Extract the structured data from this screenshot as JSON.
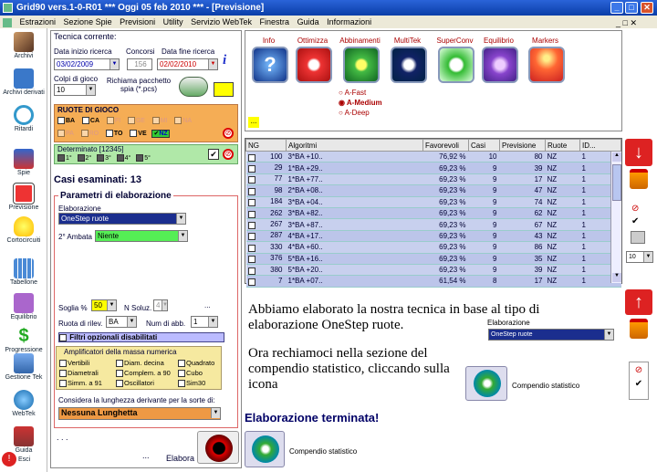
{
  "window": {
    "title": "Grid90 vers.1-0-R01   ***  Oggi 05 feb 2010   ***   - [Previsione]"
  },
  "menu": [
    "Estrazioni",
    "Sezione Spie",
    "Previsioni",
    "Utility",
    "Servizio WebTek",
    "Finestra",
    "Guida",
    "Informazioni"
  ],
  "sidebar": [
    "Archivi",
    "Archivi derivati",
    "Ritardi",
    "Spie",
    "Previsione",
    "Cortocircuiti",
    "Tabellone",
    "Equilibrio",
    "Progressione",
    "Gestione Tek",
    "WebTek",
    "Guida",
    "Esci"
  ],
  "tecnica": {
    "title": "Tecnica corrente:",
    "data_inizio_label": "Data inizio ricerca",
    "data_inizio": "03/02/2009",
    "concorsi_label": "Concorsi",
    "concorsi": "156",
    "data_fine_label": "Data fine ricerca",
    "data_fine": "02/02/2010",
    "colpi_label": "Colpi di gioco",
    "colpi": "10",
    "richiama_label": "Richiama pacchetto spia (*.pcs)",
    "ruote_title": "RUOTE DI GIOCO",
    "ruote_row1": [
      "BA",
      "CA",
      "FI",
      "GE",
      "MI",
      "NA"
    ],
    "ruote_row2": [
      "PA",
      "RO",
      "TO",
      "VE",
      "NZ"
    ],
    "determinato_title": "Determinato [12345]",
    "determinato": [
      "1°",
      "2°",
      "3°",
      "4°",
      "5°"
    ],
    "casi": "Casi esaminati: 13",
    "parametri_title": "Parametri di elaborazione",
    "elaborazione_label": "Elaborazione",
    "elaborazione": "OneStep ruote",
    "ambata_label": "2° Ambata",
    "ambata": "Niente",
    "soglia_label": "Soglia %",
    "soglia": "50",
    "nsoluz_label": "N Soluz.",
    "nsoluz": "4",
    "ruota_rilev_label": "Ruota di rilev.",
    "ruota_rilev": "BA",
    "num_abb_label": "Num di abb.",
    "num_abb": "1",
    "filtri": "Filtri opzionali disabilitati",
    "ampli_title": "Amplificatori della massa numerica",
    "ampli": [
      "Vertibili",
      "Diam. decina",
      "Quadrato",
      "Diametrali",
      "Complem. a 90",
      "Cubo",
      "Simm. a 91",
      "Oscillatori",
      "Sim30"
    ],
    "lunghezza_label": "Considera la lunghezza derivante per la sorte di:",
    "lunghezza": "Nessuna Lunghetta",
    "dots1": ". . .",
    "dots2": "...",
    "elabora": "Elabora"
  },
  "methods": {
    "labels": [
      "Info",
      "Ottimizza",
      "Abbinamenti",
      "MultiTek",
      "SuperConv",
      "Equilibrio",
      "Markers"
    ],
    "radios": [
      "A-Fast",
      "A-Medium",
      "A-Deep"
    ],
    "dots": "..."
  },
  "grid": {
    "headers": [
      "NG",
      "Algoritmi",
      "Favorevoli",
      "Casi",
      "Previsione",
      "Ruote",
      "ID..."
    ],
    "rows": [
      [
        "100",
        "3*BA +10..",
        "76,92 %",
        "10",
        "80",
        "NZ",
        "1"
      ],
      [
        "29",
        "1*BA +29..",
        "69,23 %",
        "9",
        "39",
        "NZ",
        "1"
      ],
      [
        "77",
        "1*BA +77..",
        "69,23 %",
        "9",
        "17",
        "NZ",
        "1"
      ],
      [
        "98",
        "2*BA +08..",
        "69,23 %",
        "9",
        "47",
        "NZ",
        "1"
      ],
      [
        "184",
        "3*BA +04..",
        "69,23 %",
        "9",
        "74",
        "NZ",
        "1"
      ],
      [
        "262",
        "3*BA +82..",
        "69,23 %",
        "9",
        "62",
        "NZ",
        "1"
      ],
      [
        "267",
        "3*BA +87..",
        "69,23 %",
        "9",
        "67",
        "NZ",
        "1"
      ],
      [
        "287",
        "4*BA +17..",
        "69,23 %",
        "9",
        "43",
        "NZ",
        "1"
      ],
      [
        "330",
        "4*BA +60..",
        "69,23 %",
        "9",
        "86",
        "NZ",
        "1"
      ],
      [
        "376",
        "5*BA +16..",
        "69,23 %",
        "9",
        "35",
        "NZ",
        "1"
      ],
      [
        "380",
        "5*BA +20..",
        "69,23 %",
        "9",
        "39",
        "NZ",
        "1"
      ],
      [
        "7",
        "1*BA +07..",
        "61,54 %",
        "8",
        "17",
        "NZ",
        "1"
      ]
    ]
  },
  "right": {
    "combo": "10"
  },
  "tutorial": {
    "p1": "Abbiamo elaborato la nostra tecnica in base al tipo di elaborazione OneStep ruote.",
    "elab_label": "Elaborazione",
    "elab_value": "OneStep ruote",
    "p2": "Ora rechiamoci nella sezione del compendio statistico, cliccando sulla icona",
    "compendio1": "Compendio statistico",
    "terminata": "Elaborazione terminata!",
    "compendio2": "Compendio statistico"
  }
}
